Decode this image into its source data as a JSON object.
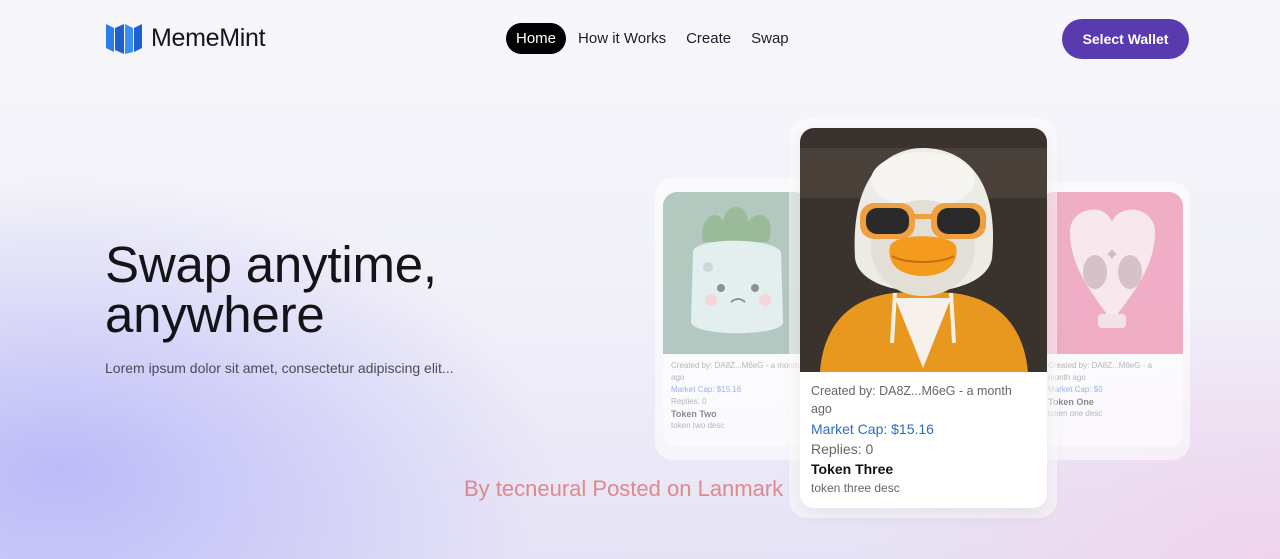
{
  "brand": {
    "name": "MemeMint",
    "logo_icon": "brand-logo-icon",
    "logo_color": "#2b7de9"
  },
  "nav": {
    "items": [
      {
        "label": "Home",
        "active": true
      },
      {
        "label": "How it Works",
        "active": false
      },
      {
        "label": "Create",
        "active": false
      },
      {
        "label": "Swap",
        "active": false
      }
    ]
  },
  "header": {
    "wallet_button": "Select Wallet",
    "wallet_color": "#5a3aaf"
  },
  "hero": {
    "title_line1": "Swap anytime,",
    "title_line2": "anywhere",
    "subtitle": "Lorem ipsum dolor sit amet, consectetur adipiscing elit..."
  },
  "cards": {
    "left": {
      "creator": "Created by: DA8Z...M6eG - a month ago",
      "market_cap": "Market Cap: $15.16",
      "replies": "Replies: 0",
      "name": "Token Two",
      "desc": "token two desc",
      "image_icon": "plant-creature-image"
    },
    "center": {
      "creator": "Created by: DA8Z...M6eG - a month ago",
      "market_cap": "Market Cap: $15.16",
      "replies": "Replies: 0",
      "name": "Token Three",
      "desc": "token three desc",
      "image_icon": "duck-hoodie-image"
    },
    "right": {
      "creator": "Created by: DA8Z...M6eG - a month ago",
      "market_cap": "Market Cap: $0",
      "name": "Token One",
      "desc": "token one desc",
      "image_icon": "pink-skull-heart-image"
    }
  },
  "watermark": "By tecneural Posted on Lanmark"
}
